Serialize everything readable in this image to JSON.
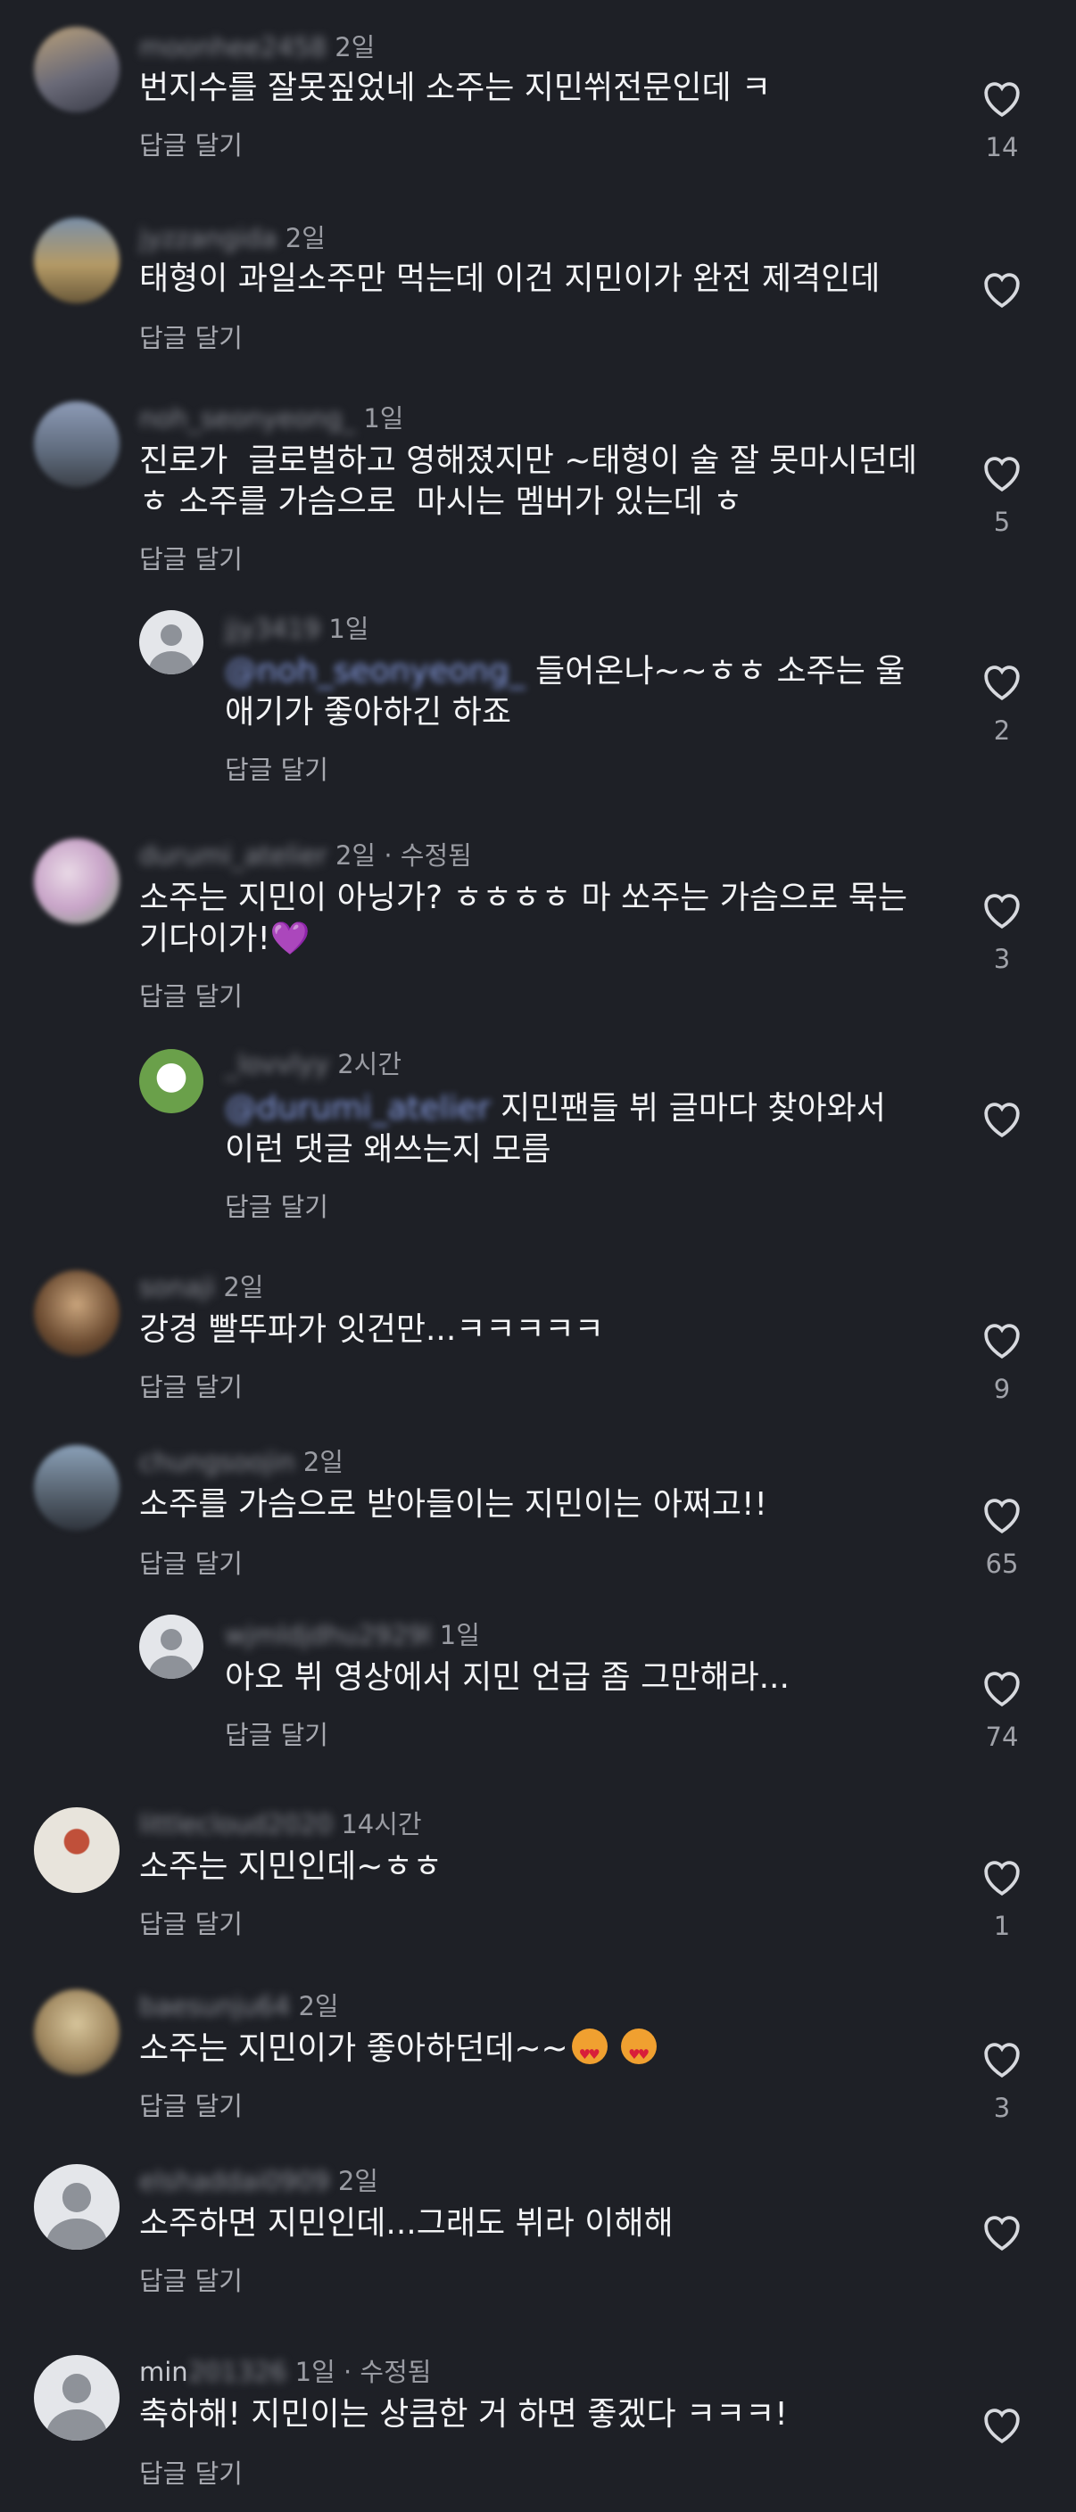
{
  "ui": {
    "reply_label": "답글 달기",
    "heart_icon": "heart-outline-icon",
    "accent": "#1e2026"
  },
  "comments": [
    {
      "user": "moonhee2458",
      "time": "2일",
      "text": "번지수를 잘못짚었네 소주는 지민쒸전문인데 ㅋ",
      "likes": "14"
    },
    {
      "user": "jyzzangida",
      "time": "2일",
      "text": "태형이 과일소주만 먹는데 이건 지민이가 완전 제격인데",
      "likes": ""
    },
    {
      "user": "noh_seonyeong_",
      "time": "1일",
      "text": "진로가  글로벌하고 영해졌지만 ~태형이 술 잘 못마시던데\nㅎ 소주를 가슴으로  마시는 멤버가 있는데 ㅎ",
      "likes": "5"
    },
    {
      "user": "jjy3419",
      "time": "1일",
      "mention": "@noh_seonyeong_",
      "text": "들어온나~~ㅎㅎ 소주는 울\n애기가 좋아하긴 하죠",
      "likes": "2"
    },
    {
      "user": "durumi_atelier",
      "time": "2일 · 수정됨",
      "text": "소주는 지민이 아닝가? ㅎㅎㅎㅎ 마 쏘주는 가슴으로 묵는\n기다이가!",
      "emoji": "💜",
      "likes": "3"
    },
    {
      "user": "_lovvlyy",
      "time": "2시간",
      "mention": "@durumi_atelier",
      "text": "지민팬들 뷔 글마다 찾아와서\n이런 댓글 왜쓰는지 모름",
      "likes": ""
    },
    {
      "user": "sonaji",
      "time": "2일",
      "text": "강경 빨뚜파가 잇건만...ㅋㅋㅋㅋㅋ",
      "likes": "9"
    },
    {
      "user": "chungsoojin",
      "time": "2일",
      "text": "소주를 가슴으로 받아들이는 지민이는 아쩌고!!",
      "likes": "65"
    },
    {
      "user": "wjmldjdhu2929l",
      "time": "1일",
      "text": "아오 뷔 영상에서 지민 언급 좀 그만해라...",
      "likes": "74"
    },
    {
      "user": "littlecloud2020",
      "time": "14시간",
      "text": "소주는 지민인데~ㅎㅎ",
      "likes": "1"
    },
    {
      "user": "baesunju64",
      "time": "2일",
      "text": "소주는 지민이가 좋아하던데~~",
      "likes": "3"
    },
    {
      "user": "elshaddai0909",
      "time": "2일",
      "text": "소주하면 지민인데...그래도 뷔라 이해해",
      "likes": ""
    },
    {
      "user_visible": "min",
      "user_hidden": "201326",
      "time": "1일 · 수정됨",
      "text": "축하해! 지민이는 상큼한 거 하면 좋겠다 ㅋㅋㅋ!",
      "likes": ""
    }
  ]
}
